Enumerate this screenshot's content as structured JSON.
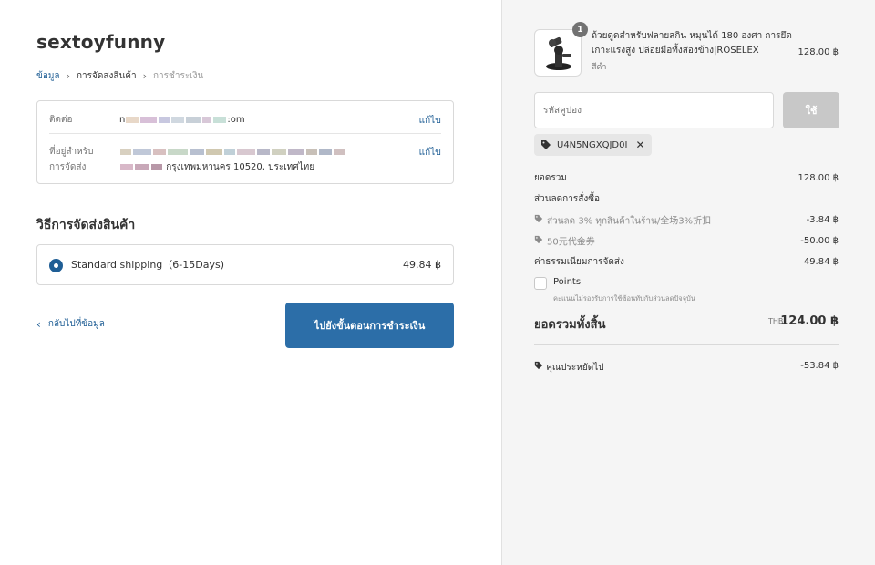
{
  "store": {
    "name": "sextoyfunny"
  },
  "breadcrumb": [
    {
      "label": "ข้อมูล"
    },
    {
      "label": "การจัดส่งสินค้า"
    },
    {
      "label": "การชำระเงิน"
    }
  ],
  "review": {
    "contact_label": "ติดต่อ",
    "contact_value_start": "n",
    "contact_value_end": ":om",
    "address_label_line1": "ที่อยู่สำหรับ",
    "address_label_line2": "การจัดส่ง",
    "address_value_end": "กรุงเทพมหานคร 10520, ประเทศไทย",
    "edit_label": "แก้ไข"
  },
  "shipping_method": {
    "title": "วิธีการจัดส่งสินค้า",
    "option_label": "Standard shipping（6-15Days)",
    "option_price": "49.84 ฿"
  },
  "nav": {
    "back_label": "กลับไปที่ข้อมูล",
    "continue_label": "ไปยังขั้นตอนการชำระเงิน"
  },
  "product": {
    "quantity": "1",
    "name": "ถ้วยดูดสำหรับฟลายสกิน หมุนได้ 180 องศา การยึดเกาะแรงสูง ปล่อยมือทั้งสองข้าง|ROSELEX",
    "variant": "สีดำ",
    "price": "128.00 ฿"
  },
  "coupon": {
    "placeholder": "รหัสคูปอง",
    "apply_label": "ใช้",
    "applied_code": "U4N5NGXQJD0I"
  },
  "summary": {
    "subtotal_label": "ยอดรวม",
    "subtotal_value": "128.00 ฿",
    "order_discount_label": "ส่วนลดการสั่งซื้อ",
    "discount1_label": "ส่วนลด 3% ทุกสินค้าในร้าน/全场3%折扣",
    "discount1_value": "-3.84 ฿",
    "discount2_label": "50元代金券",
    "discount2_value": "-50.00 ฿",
    "shipping_label": "ค่าธรรมเนียมการจัดส่ง",
    "shipping_value": "49.84 ฿",
    "points_label": "Points",
    "points_note": "คะแนนไม่รองรับการใช้ซ้อนทับกับส่วนลดปัจจุบัน",
    "total_label": "ยอดรวมทั้งสิ้น",
    "total_currency": "THB",
    "total_value": "124.00 ฿",
    "saved_label": "คุณประหยัดไป",
    "saved_value": "-53.84 ฿"
  },
  "colors": {
    "accent": "#2c6ea8",
    "link": "#1f5e95",
    "sidebar_bg": "#f5f5f5"
  }
}
